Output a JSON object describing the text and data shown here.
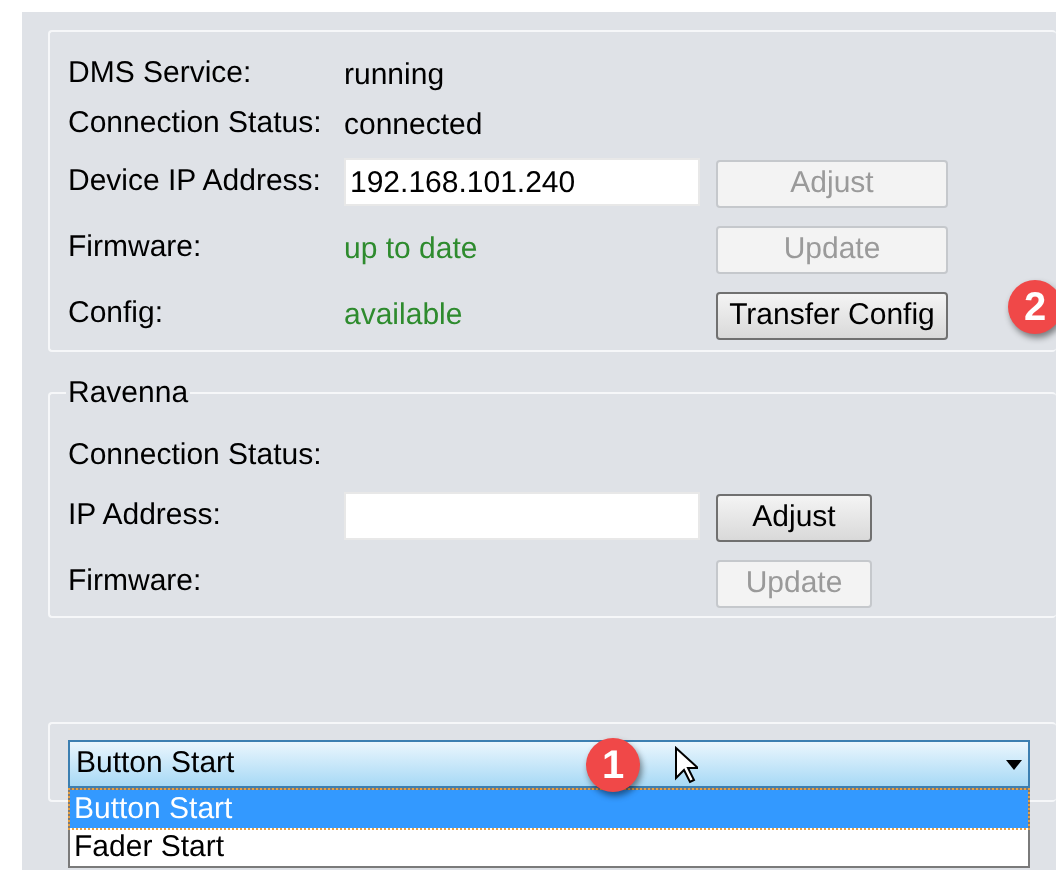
{
  "dms": {
    "rows": [
      {
        "kind": "text",
        "label": "DMS Service:",
        "value": "running",
        "ok": false
      },
      {
        "kind": "text",
        "label": "Connection Status:",
        "value": "connected",
        "ok": false
      },
      {
        "kind": "field",
        "label": "Device IP Address:",
        "value": "192.168.101.240",
        "button": {
          "label": "Adjust",
          "disabled": true
        }
      },
      {
        "kind": "text",
        "label": "Firmware:",
        "value": "up to date",
        "ok": true,
        "button": {
          "label": "Update",
          "disabled": true
        }
      },
      {
        "kind": "text",
        "label": "Config:",
        "value": "available",
        "ok": true,
        "button": {
          "label": "Transfer Config",
          "disabled": false
        },
        "badge": "2"
      }
    ]
  },
  "ravenna": {
    "title": "Ravenna",
    "rows": [
      {
        "kind": "text",
        "label": "Connection Status:"
      },
      {
        "kind": "field",
        "label": "IP Address:",
        "button": {
          "label": "Adjust",
          "disabled": false
        }
      },
      {
        "kind": "text",
        "label": "Firmware:",
        "button": {
          "label": "Update",
          "disabled": true
        }
      }
    ]
  },
  "start_mode": {
    "value": "Button Start",
    "expanded": true,
    "badge": "1",
    "options": [
      {
        "label": "Button Start",
        "selected": true
      },
      {
        "label": "Fader Start",
        "selected": false
      }
    ]
  }
}
